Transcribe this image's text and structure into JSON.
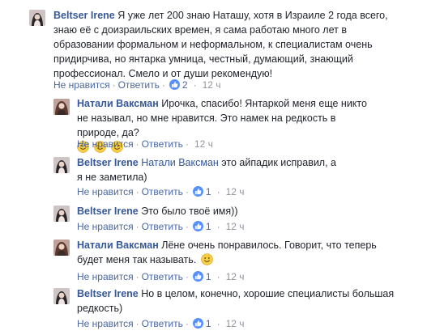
{
  "comments": [
    {
      "author": "Beltser Irene",
      "text": "Я уже лет 200 знаю Наташу, хотя в Израиле 2 года всего, знаю её с доизраильских времен, я сама работаю много лет в образовании формальном и неформальном, к специалистам очень придирчива, но янтарка умница, честный, думающий, знающий профессионал. Смело и от души рекомендую!",
      "unlike": "Не нравится",
      "reply": "Ответить",
      "likes": "2",
      "time": "12 ч"
    },
    {
      "author": "Натали Ваксман",
      "text": "Ирочка, спасибо! Янтаркой меня еще никто не называл, но мне нравится. Это намек на редкость в природе, да?",
      "emojis": [
        "smiley",
        "smiley",
        "smiley"
      ],
      "unlike": "Не нравится",
      "reply": "Ответить",
      "time": "12 ч"
    },
    {
      "author": "Beltser Irene",
      "mention": "Натали Ваксман",
      "text": "это айпадик исправил, а я не заметила)",
      "unlike": "Не нравится",
      "reply": "Ответить",
      "likes": "1",
      "time": "12 ч"
    },
    {
      "author": "Beltser Irene",
      "text": "Это было твоё имя))",
      "unlike": "Не нравится",
      "reply": "Ответить",
      "likes": "1",
      "time": "12 ч"
    },
    {
      "author": "Натали Ваксман",
      "text": "Лёне очень понравилось. Говорит, что теперь будет меня так называть.",
      "emojis": [
        "smiley"
      ],
      "unlike": "Не нравится",
      "reply": "Ответить",
      "likes": "1",
      "time": "12 ч"
    },
    {
      "author": "Beltser Irene",
      "text": "Но в целом, конечно, хорошие специалисты большая редкость)",
      "unlike": "Не нравится",
      "reply": "Ответить",
      "likes": "1",
      "time": "12 ч"
    }
  ],
  "separator": "·",
  "colors": {
    "link": "#365899",
    "meta": "#90949c",
    "like_badge": "#5890ff"
  }
}
